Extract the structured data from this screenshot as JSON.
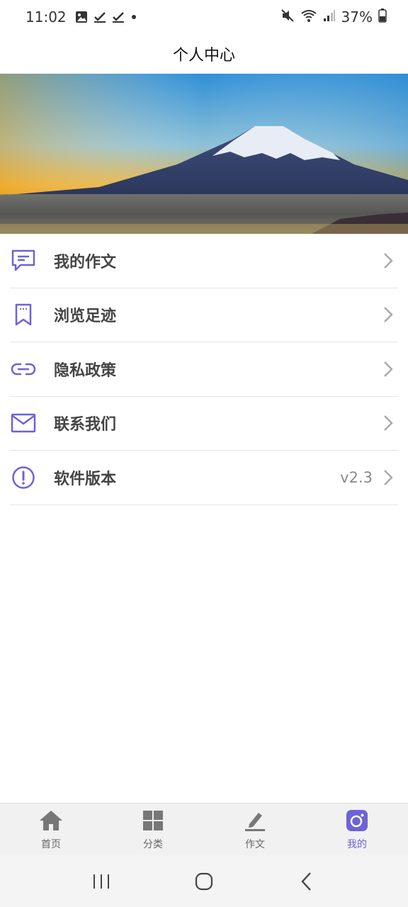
{
  "status_bar": {
    "time": "11:02",
    "battery": "37%",
    "icons": [
      "image-icon",
      "check-icon",
      "check-icon",
      "dot-icon",
      "mute-icon",
      "wifi-icon",
      "signal-icon",
      "battery-icon"
    ]
  },
  "header": {
    "title": "个人中心"
  },
  "menu": {
    "items": [
      {
        "label": "我的作文",
        "icon": "comment-icon"
      },
      {
        "label": "浏览足迹",
        "icon": "bookmark-icon"
      },
      {
        "label": "隐私政策",
        "icon": "link-icon"
      },
      {
        "label": "联系我们",
        "icon": "mail-icon"
      },
      {
        "label": "软件版本",
        "icon": "info-icon",
        "value": "v2.3"
      }
    ]
  },
  "tabbar": {
    "tabs": [
      {
        "label": "首页",
        "icon": "home-icon"
      },
      {
        "label": "分类",
        "icon": "grid-icon"
      },
      {
        "label": "作文",
        "icon": "pen-icon"
      },
      {
        "label": "我的",
        "icon": "user-camera-icon",
        "active": true
      }
    ]
  },
  "colors": {
    "accent": "#6c63d6",
    "label": "#444444",
    "divider": "#e6e6e6"
  }
}
